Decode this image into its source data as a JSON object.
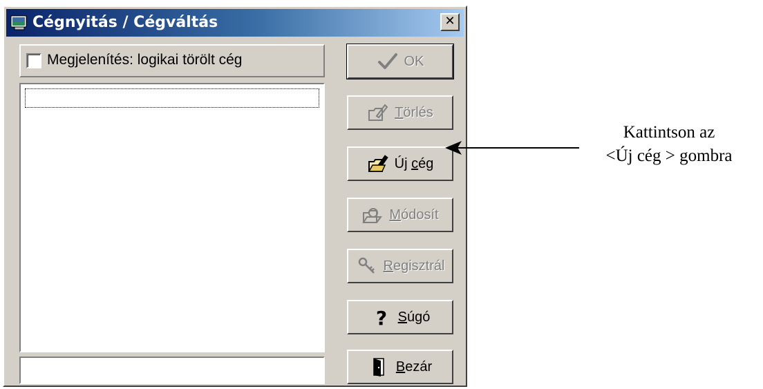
{
  "window": {
    "title": "Cégnyitás / Cégváltás",
    "close_symbol": "✕"
  },
  "filter": {
    "checkbox_label": "Megjelenítés: logikai törölt cég",
    "checked": false
  },
  "list": {
    "items": []
  },
  "status_field": {
    "value": ""
  },
  "buttons": {
    "ok": {
      "label": "OK",
      "icon": "checkmark-icon",
      "enabled": false
    },
    "delete": {
      "prefix": "",
      "mnemonic": "T",
      "suffix": "örlés",
      "icon": "folder-pen-icon",
      "enabled": false
    },
    "new_company": {
      "prefix": "Új ",
      "mnemonic": "c",
      "suffix": "ég",
      "icon": "folder-pen-icon",
      "enabled": true
    },
    "modify": {
      "prefix": "",
      "mnemonic": "M",
      "suffix": "ódosít",
      "icon": "folder-edit-icon",
      "enabled": false
    },
    "register": {
      "prefix": "",
      "mnemonic": "R",
      "suffix": "egisztrál",
      "icon": "key-icon",
      "enabled": false
    },
    "help": {
      "prefix": "",
      "mnemonic": "S",
      "suffix": "úgó",
      "icon": "question-mark-icon",
      "enabled": true
    },
    "close": {
      "prefix": "",
      "mnemonic": "B",
      "suffix": "ezár",
      "icon": "door-icon",
      "enabled": true
    }
  },
  "annotation": {
    "line1": "Kattintson az",
    "line2": "<Új cég > gombra"
  },
  "colors": {
    "titlebar_start": "#0a246a",
    "titlebar_end": "#a6caf0",
    "face": "#d4d0c8",
    "disabled_text": "#808080"
  }
}
